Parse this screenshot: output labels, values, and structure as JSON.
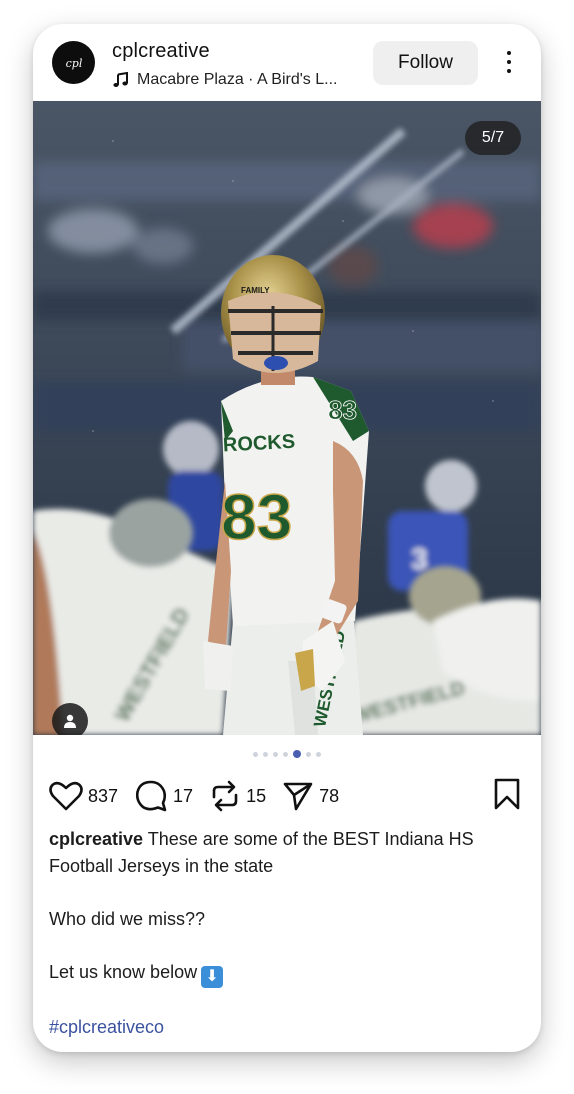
{
  "post": {
    "username": "cplcreative",
    "avatar_text": "cpl",
    "music": "Macabre Plaza · A Bird's L...",
    "follow_label": "Follow",
    "image_counter": "5/7",
    "image_description": "High school football player in white #83 ROCKS jersey with gold helmet standing on field"
  },
  "carousel": {
    "total": 7,
    "active_index": 4
  },
  "actions": {
    "likes": "837",
    "comments": "17",
    "reposts": "15",
    "shares": "78"
  },
  "caption": {
    "username": "cplcreative",
    "text": "These are some of the BEST Indiana HS Football Jerseys in the state",
    "line2": "Who did we miss??",
    "line3": "Let us know below",
    "emoji": "⬇",
    "hashtag": "#cplcreativeco"
  },
  "jersey": {
    "number": "83",
    "team": "ROCKS",
    "pants_text": "WESTFIELD",
    "helmet_text": "FAMILY"
  },
  "colors": {
    "accent": "#3b52a0",
    "jersey_green": "#1f5a2e",
    "helmet_gold": "#b8a25a"
  },
  "icons": [
    "music-note-icon",
    "more-vertical-icon",
    "user-tag-icon",
    "heart-icon",
    "comment-icon",
    "repost-icon",
    "share-icon",
    "bookmark-icon"
  ]
}
